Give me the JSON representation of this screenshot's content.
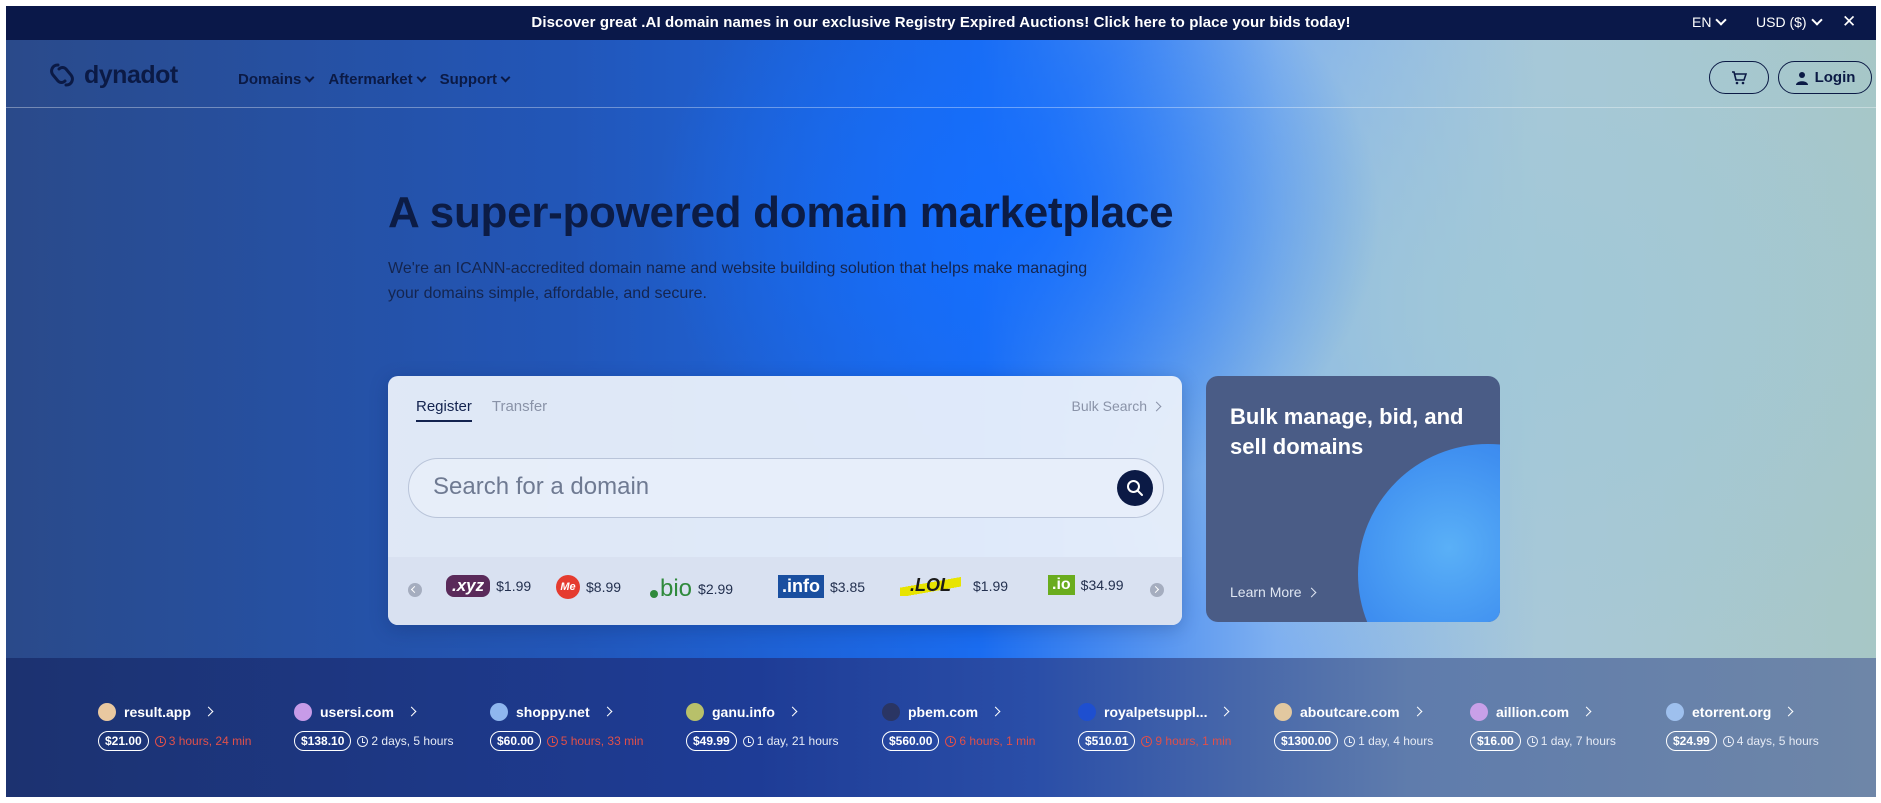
{
  "banner": {
    "text": "Discover great .AI domain names in our exclusive Registry Expired Auctions! Click here to place your bids today!",
    "language": "EN",
    "currency": "USD ($)",
    "close": "✕"
  },
  "nav": {
    "logo_text": "dynadot",
    "menu": [
      "Domains",
      "Aftermarket",
      "Support"
    ],
    "login_label": "Login"
  },
  "hero": {
    "title": "A super-powered domain marketplace",
    "subtitle": "We're an ICANN-accredited domain name and website building solution that helps make managing your domains simple, affordable, and secure."
  },
  "search": {
    "tabs": [
      "Register",
      "Transfer"
    ],
    "active_tab": "Register",
    "bulk_search": "Bulk Search",
    "placeholder": "Search for a domain"
  },
  "tlds": [
    {
      "logo": ".xyz",
      "price": "$1.99",
      "color": "#5a2a5a"
    },
    {
      "logo": "Me",
      "price": "$8.99",
      "color": "#e53b2f"
    },
    {
      "logo": "bio",
      "price": "$2.99",
      "color": "#2f8a3c"
    },
    {
      "logo": ".info",
      "price": "$3.85",
      "color": "#1a4fa0"
    },
    {
      "logo": ".LOL",
      "price": "$1.99",
      "color": "#1b1b1b"
    },
    {
      "logo": ".io",
      "price": "$34.99",
      "color": "#6aac1e"
    }
  ],
  "promo": {
    "title": "Bulk manage, bid, and sell domains",
    "link": "Learn More"
  },
  "auctions": [
    {
      "name": "result.app",
      "price": "$21.00",
      "time": "3 hours, 24 min",
      "urgent": true,
      "dot": "#e9c8a0"
    },
    {
      "name": "usersi.com",
      "price": "$138.10",
      "time": "2 days, 5 hours",
      "urgent": false,
      "dot": "#c79be8"
    },
    {
      "name": "shoppy.net",
      "price": "$60.00",
      "time": "5 hours, 33 min",
      "urgent": true,
      "dot": "#8fb6ee"
    },
    {
      "name": "ganu.info",
      "price": "$49.99",
      "time": "1 day, 21 hours",
      "urgent": false,
      "dot": "#b8c06a"
    },
    {
      "name": "pbem.com",
      "price": "$560.00",
      "time": "6 hours, 1 min",
      "urgent": true,
      "dot": "#2a3563"
    },
    {
      "name": "royalpetsuppl...",
      "price": "$510.01",
      "time": "9 hours, 1 min",
      "urgent": true,
      "dot": "#1e4fd0"
    },
    {
      "name": "aboutcare.com",
      "price": "$1300.00",
      "time": "1 day, 4 hours",
      "urgent": false,
      "dot": "#e2c8a0"
    },
    {
      "name": "aillion.com",
      "price": "$16.00",
      "time": "1 day, 7 hours",
      "urgent": false,
      "dot": "#c9a0e8"
    },
    {
      "name": "etorrent.org",
      "price": "$24.99",
      "time": "4 days, 5 hours",
      "urgent": false,
      "dot": "#9ec0ee"
    }
  ]
}
